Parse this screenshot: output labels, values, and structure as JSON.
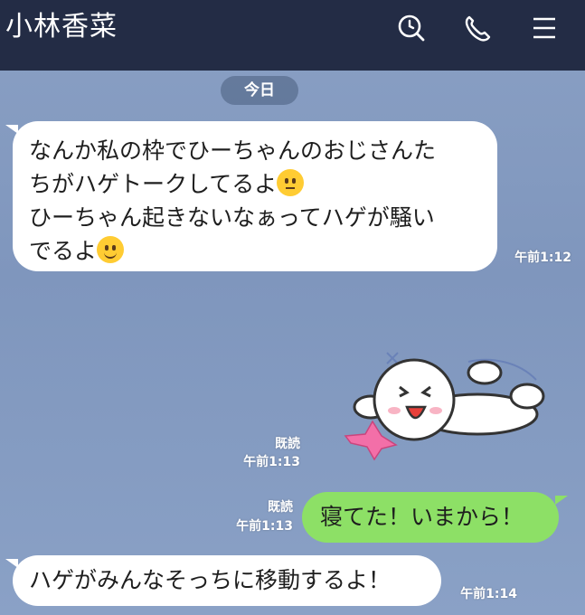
{
  "header": {
    "title": "小林香菜",
    "icons": [
      "search-icon",
      "phone-icon",
      "menu-icon"
    ]
  },
  "date_divider": "今日",
  "messages": [
    {
      "line1": "なんか私の枠でひーちゃんのおじさんた",
      "line2": "ちがハゲトークしてるよ",
      "line3": "ひーちゃん起きないなぁってハゲが騒い",
      "line4": "でるよ",
      "time": "午前1:12",
      "emojis": [
        "thinking-face",
        "smiling-face"
      ]
    },
    {
      "type": "sticker",
      "read": "既読",
      "time": "午前1:13"
    },
    {
      "text": "寝てた！いまから！",
      "read": "既読",
      "time": "午前1:13"
    },
    {
      "text": "ハゲがみんなそっちに移動するよ！",
      "time": "午前1:14"
    }
  ],
  "colors": {
    "header_bg": "#232c45",
    "chat_bg": "#8aa0c4",
    "incoming_bubble": "#ffffff",
    "outgoing_bubble": "#8de066"
  }
}
